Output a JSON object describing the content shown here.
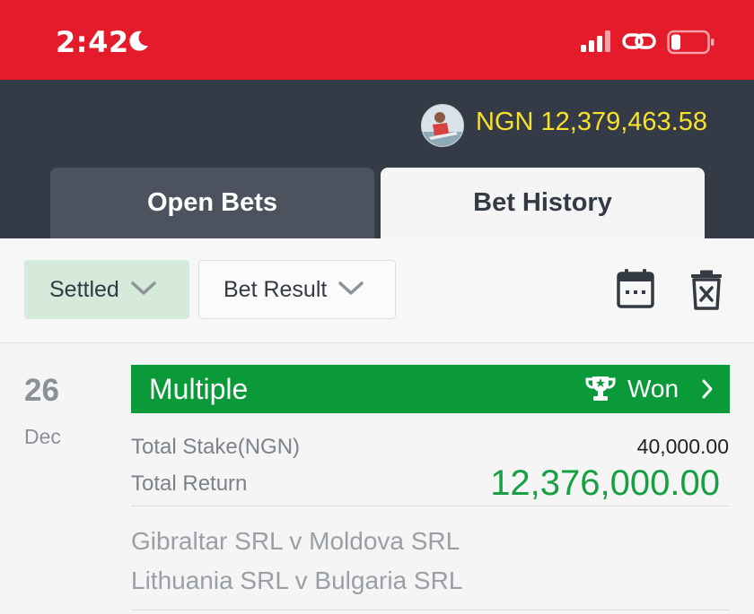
{
  "status_bar": {
    "time": "2:42",
    "icons": [
      "moon-icon",
      "signal-icon",
      "link-icon",
      "battery-icon"
    ]
  },
  "header": {
    "balance": "NGN 12,379,463.58",
    "tabs": [
      {
        "label": "Open Bets",
        "active": false
      },
      {
        "label": "Bet History",
        "active": true
      }
    ]
  },
  "filters": {
    "status_dropdown": "Settled",
    "result_dropdown": "Bet Result",
    "icons": [
      "calendar-icon",
      "delete-icon"
    ]
  },
  "bets": [
    {
      "day": "26",
      "month": "Dec",
      "type": "Multiple",
      "result": "Won",
      "stake_label": "Total Stake(NGN)",
      "stake_value": "40,000.00",
      "return_label": "Total Return",
      "return_value": "12,376,000.00",
      "matches": [
        "Gibraltar SRL v Moldova SRL",
        "Lithuania SRL v Bulgaria SRL"
      ]
    }
  ],
  "colors": {
    "status_bar": "#e41b2b",
    "header": "#343a46",
    "balance": "#f7e12a",
    "won": "#0b9a39",
    "return": "#17a043"
  }
}
